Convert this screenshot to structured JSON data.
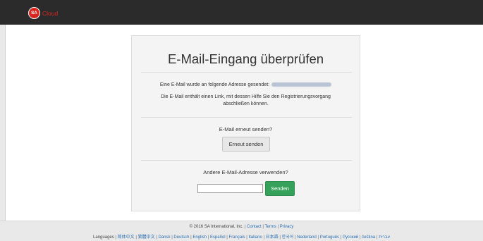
{
  "header": {
    "logo_initials": "SA",
    "brand_text": "Cloud",
    "brand_color": "#d8261f",
    "bar_color": "#2b2b2b"
  },
  "card": {
    "title": "E-Mail-Eingang überprüfen",
    "sent_text": "Eine E-Mail wurde an folgende Adresse gesendet:",
    "info_text": "Die E-Mail enthält einen Link, mit dessen Hilfe Sie den Registrierungsvorgang abschließen können.",
    "resend_question": "E-Mail erneut senden?",
    "resend_button": "Erneut senden",
    "other_question": "Andere E-Mail-Adresse verwenden?",
    "email_input_value": "",
    "send_button": "Senden",
    "send_button_color": "#36a15a"
  },
  "footer": {
    "copyright": "© 2016 SA International, Inc.",
    "links": [
      "Contact",
      "Terms",
      "Privacy"
    ],
    "languages_label": "Languages",
    "languages": [
      "简体中文",
      "繁體中文",
      "Dansk",
      "Deutsch",
      "English",
      "Español",
      "Français",
      "Italiano",
      "日本語",
      "한국어",
      "Nederland",
      "Português",
      "Русский",
      "čeština",
      "עברית"
    ]
  }
}
